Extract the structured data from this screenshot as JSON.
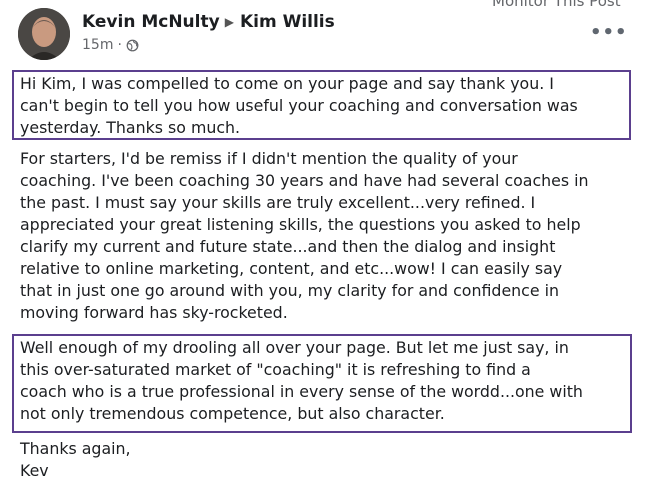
{
  "post": {
    "author": "Kevin McNulty",
    "recipient": "Kim Willis",
    "time": "15m",
    "dot": "·",
    "monitor_text": "Monitor This Post",
    "more_label": "•••"
  },
  "icons": {
    "avatar": "profile-photo",
    "share_arrow": "triangle-right-icon",
    "audience": "globe-icon",
    "more": "more-options-icon"
  },
  "colors": {
    "highlight_box": "#5b3f8e",
    "text": "#1c1e21",
    "meta": "#65676b"
  },
  "body": {
    "p1": [
      "Hi Kim, I was compelled to come on your page and say thank you.  I",
      "can't begin to tell you how useful your coaching and conversation was",
      "yesterday.  Thanks so much."
    ],
    "p2": [
      "For starters, I'd be remiss if I didn't mention the quality of your",
      "coaching. I've been coaching 30 years and have had several coaches in",
      "the past.  I must say your skills are truly excellent...very refined.  I",
      "appreciated your great listening skills, the questions you asked to help",
      "clarify my current and future state...and then the dialog and insight",
      "relative to online marketing, content, and etc...wow! I can easily say",
      "that in just one go around with you, my clarity for and confidence in",
      "moving forward has sky-rocketed."
    ],
    "p3": [
      "Well enough of my drooling all over your page.   But let me just say, in",
      "this over-saturated market of \"coaching\" it is refreshing to find a",
      "coach who is a true professional in every sense of the wordd...one with",
      "not only tremendous competence, but also character."
    ],
    "p4": [
      "Thanks again,",
      "Kev"
    ]
  }
}
